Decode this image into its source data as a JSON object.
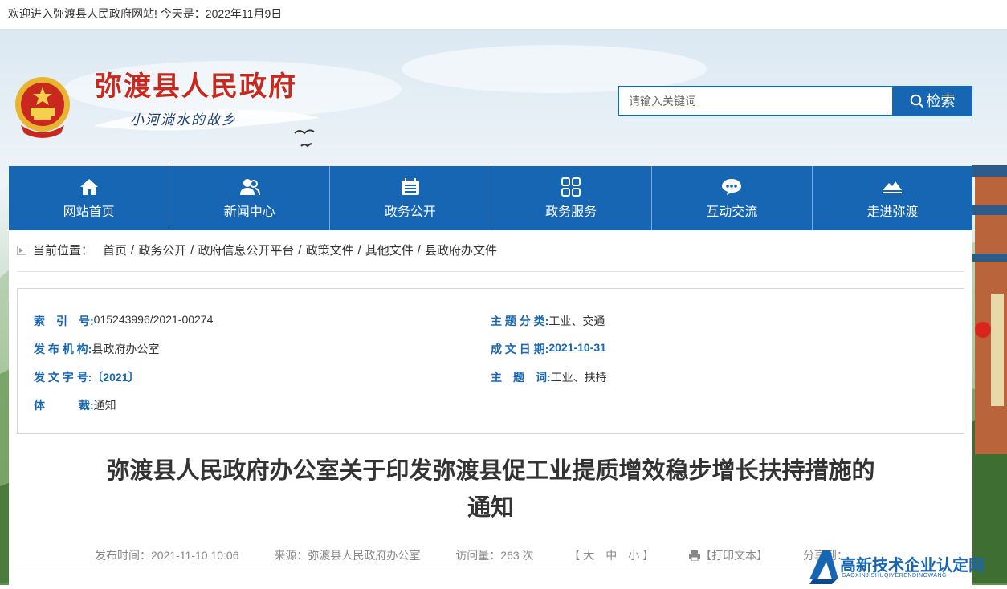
{
  "topbar": {
    "welcome": "欢迎进入弥渡县人民政府网站! 今天是：2022年11月9日"
  },
  "header": {
    "site_title": "弥渡县人民政府",
    "slogan": "小河淌水的故乡",
    "emblem_icon": "national-emblem-icon"
  },
  "search": {
    "placeholder": "请输入关键词",
    "button_label": "检索"
  },
  "nav": {
    "items": [
      {
        "label": "网站首页",
        "icon": "home-icon"
      },
      {
        "label": "新闻中心",
        "icon": "users-icon"
      },
      {
        "label": "政务公开",
        "icon": "document-list-icon"
      },
      {
        "label": "政务服务",
        "icon": "grid-icon"
      },
      {
        "label": "互动交流",
        "icon": "chat-icon"
      },
      {
        "label": "走进弥渡",
        "icon": "landscape-icon"
      }
    ]
  },
  "breadcrumb": {
    "prefix": "当前位置：",
    "items": [
      "首页",
      "政务公开",
      "政府信息公开平台",
      "政策文件",
      "其他文件",
      "县政府办文件"
    ],
    "separator": "/"
  },
  "info": {
    "index_label": "索　引　号:",
    "index_value": "015243996/2021-00274",
    "category_label": "主 题 分 类:",
    "category_value": "工业、交通",
    "issuer_label": "发 布 机 构:",
    "issuer_value": "县政府办公室",
    "date_label": "成 文 日 期:",
    "date_value": "2021-10-31",
    "docno_label": "发 文 字 号:",
    "docno_value": "〔2021〕",
    "keywords_label": "主　题　词:",
    "keywords_value": "工业、扶持",
    "genre_label": "体　　　裁:",
    "genre_value": "通知"
  },
  "article": {
    "title_line1": "弥渡县人民政府办公室关于印发弥渡县促工业提质增效稳步增长扶持措施的",
    "title_line2": "通知",
    "publish_time": "发布时间：2021-11-10 10:06",
    "source": "来源：弥渡县人民政府办公室",
    "views": "访问量：263 次",
    "font_size_label": "【 大　中　小 】",
    "print_label": "【打印文本】",
    "share_label": "分享到："
  },
  "watermark": {
    "text": "高新技术企业认定网",
    "subtext": "GAOXINJISHUQIYERENDINGWANG"
  }
}
